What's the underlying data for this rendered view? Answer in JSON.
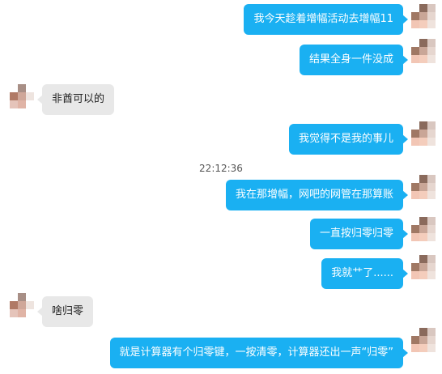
{
  "messages": [
    {
      "side": "right",
      "text": "我今天趁着增幅活动去增幅11"
    },
    {
      "side": "right",
      "text": "结果全身一件没成"
    },
    {
      "side": "left",
      "text": "非酋可以的"
    },
    {
      "side": "right",
      "text": "我觉得不是我的事儿"
    },
    {
      "side": "right",
      "text": "我在那增幅，网吧的网管在那算账"
    },
    {
      "side": "right",
      "text": "一直按归零归零"
    },
    {
      "side": "right",
      "text": "我就艹了......"
    },
    {
      "side": "left",
      "text": "啥归零"
    },
    {
      "side": "right",
      "text": "就是计算器有个归零键，一按清零，计算器还出一声“归零”"
    }
  ],
  "timestamp": "22:12:36",
  "colors": {
    "sent_bubble": "#1ab0f2",
    "received_bubble": "#e8e8e8"
  },
  "icons": {
    "avatar": "pixelated-avatar-icon"
  }
}
